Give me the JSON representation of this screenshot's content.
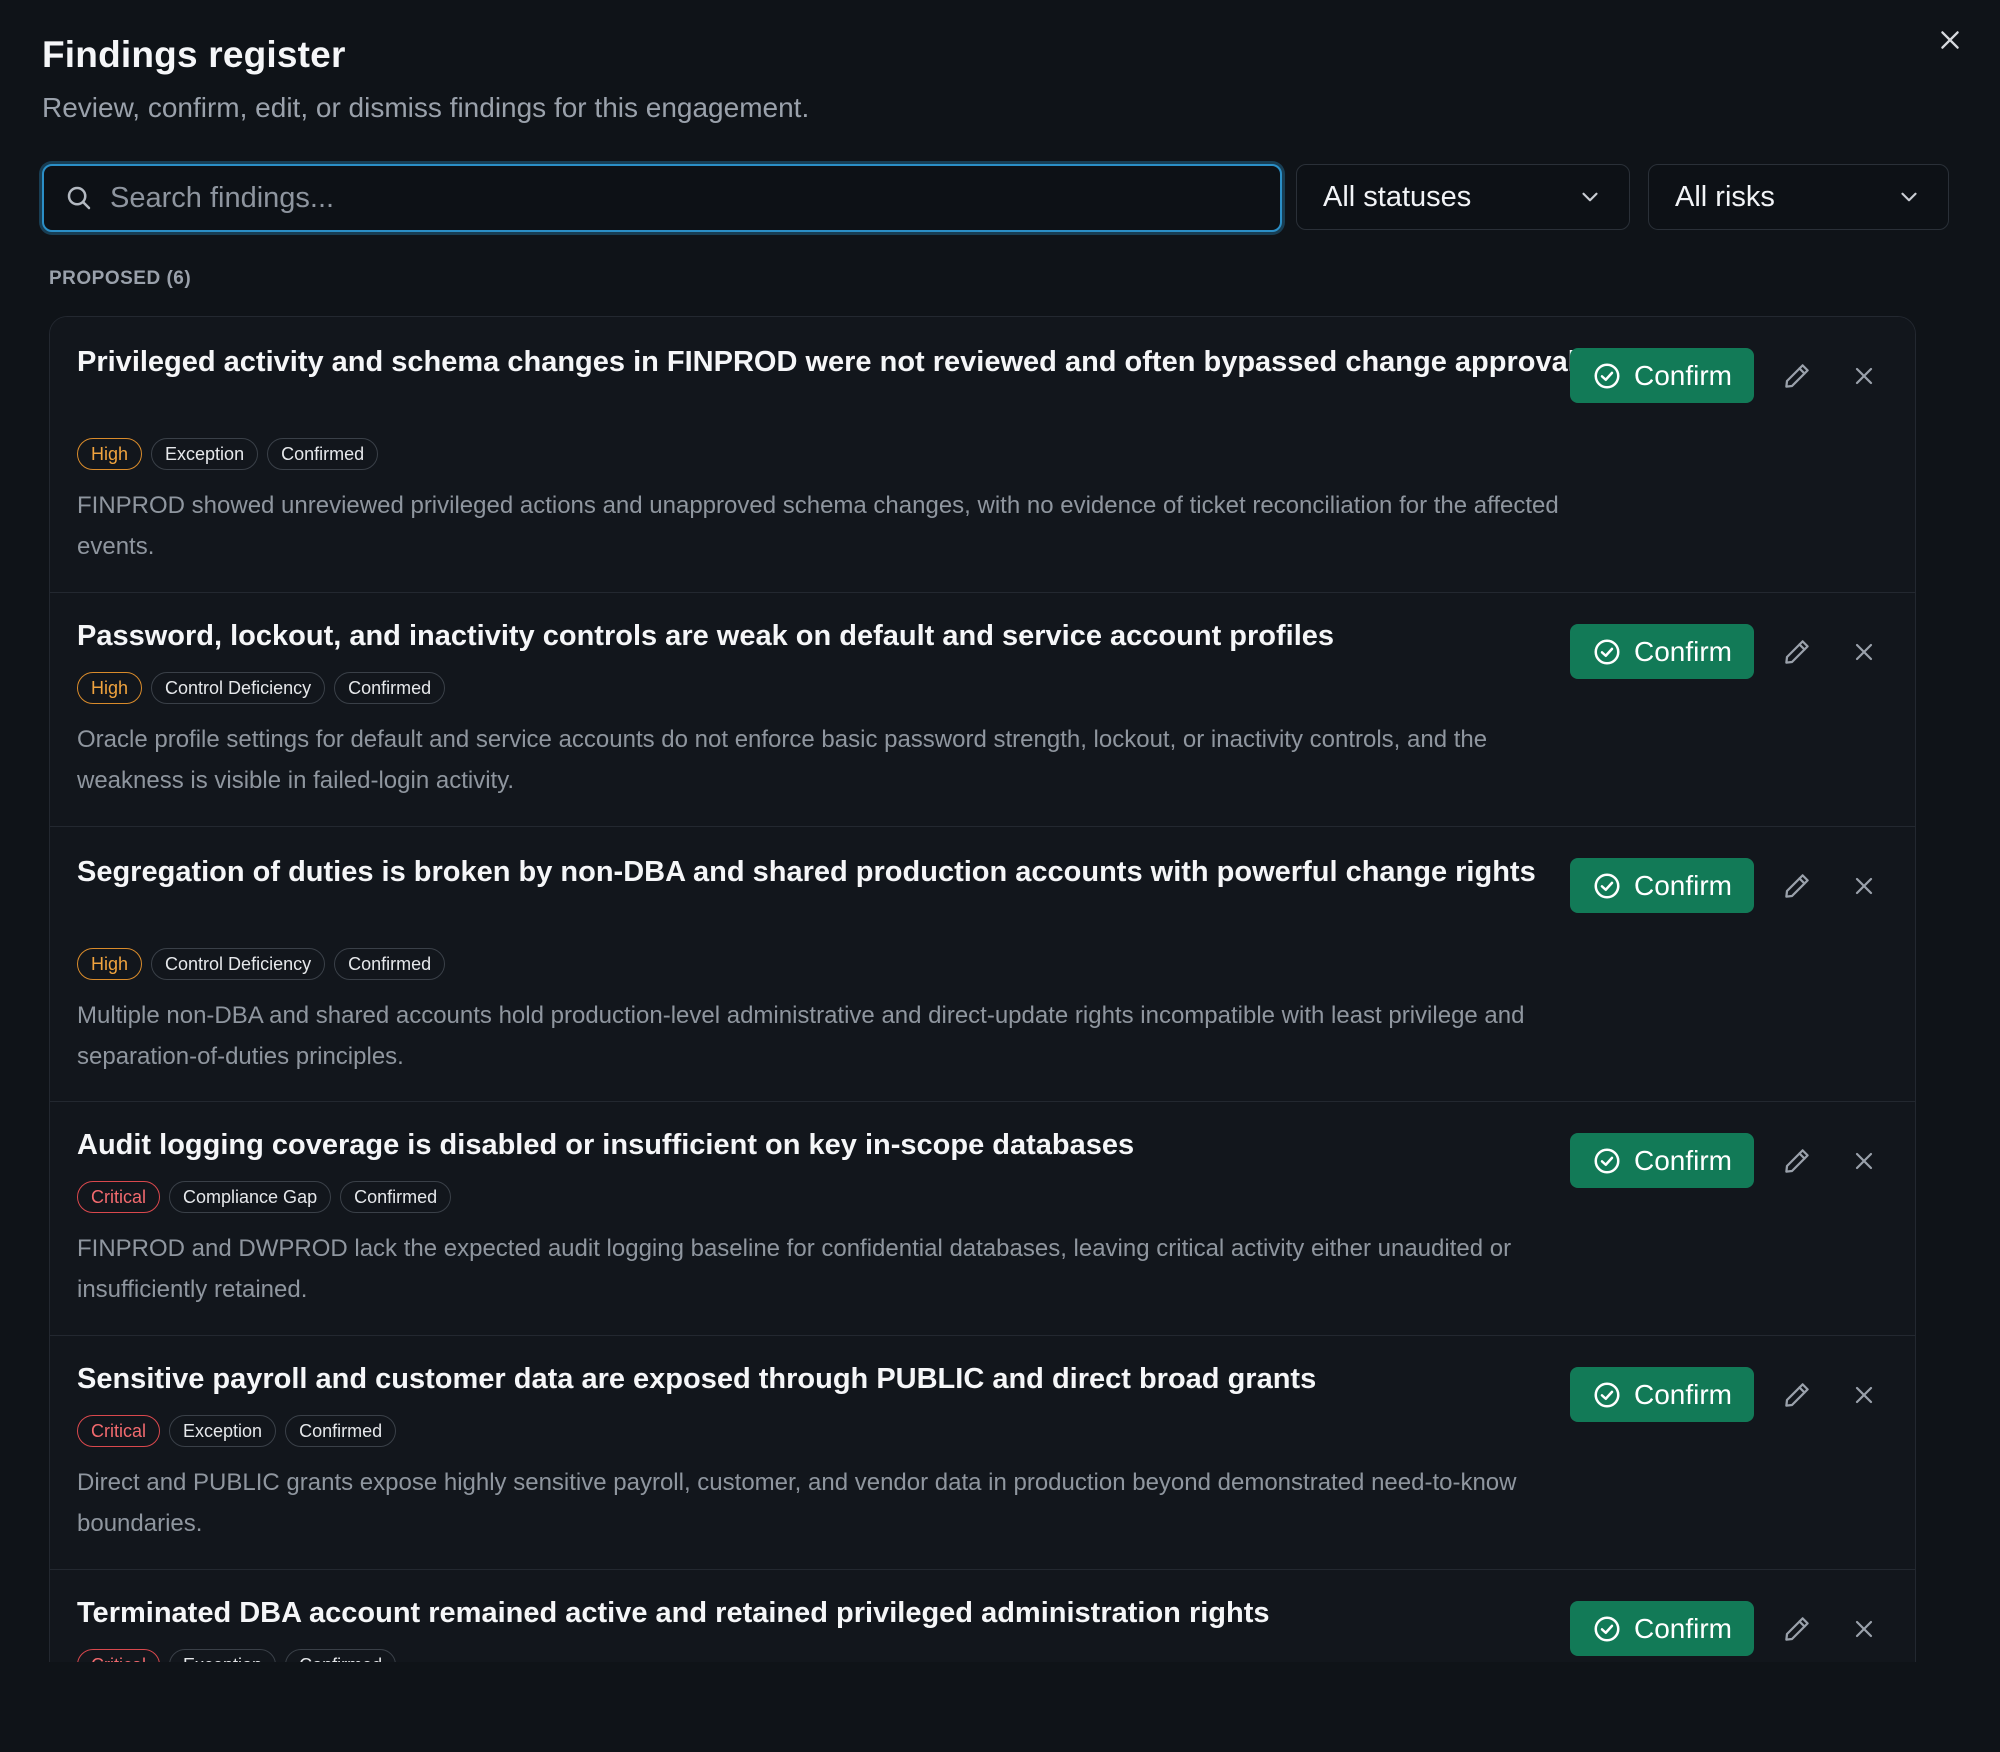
{
  "header": {
    "title": "Findings register",
    "subtitle": "Review, confirm, edit, or dismiss findings for this engagement."
  },
  "filters": {
    "search_placeholder": "Search findings...",
    "search_value": "",
    "status_selected": "All statuses",
    "risk_selected": "All risks"
  },
  "section": {
    "label": "PROPOSED (6)"
  },
  "actions": {
    "confirm_label": "Confirm"
  },
  "colors": {
    "accent_focus": "#2b8fc7",
    "confirm_green": "#127a57",
    "high": "#f0a33e",
    "critical": "#f26a6e"
  },
  "findings": [
    {
      "title": "Privileged activity and schema changes in FINPROD were not reviewed and often bypassed change approval",
      "risk": "High",
      "type": "Exception",
      "status": "Confirmed",
      "description": "FINPROD showed unreviewed privileged actions and unapproved schema changes, with no evidence of ticket reconciliation for the affected events."
    },
    {
      "title": "Password, lockout, and inactivity controls are weak on default and service account profiles",
      "risk": "High",
      "type": "Control Deficiency",
      "status": "Confirmed",
      "description": "Oracle profile settings for default and service accounts do not enforce basic password strength, lockout, or inactivity controls, and the weakness is visible in failed-login activity."
    },
    {
      "title": "Segregation of duties is broken by non-DBA and shared production accounts with powerful change rights",
      "risk": "High",
      "type": "Control Deficiency",
      "status": "Confirmed",
      "description": "Multiple non-DBA and shared accounts hold production-level administrative and direct-update rights incompatible with least privilege and separation-of-duties principles."
    },
    {
      "title": "Audit logging coverage is disabled or insufficient on key in-scope databases",
      "risk": "Critical",
      "type": "Compliance Gap",
      "status": "Confirmed",
      "description": "FINPROD and DWPROD lack the expected audit logging baseline for confidential databases, leaving critical activity either unaudited or insufficiently retained."
    },
    {
      "title": "Sensitive payroll and customer data are exposed through PUBLIC and direct broad grants",
      "risk": "Critical",
      "type": "Exception",
      "status": "Confirmed",
      "description": "Direct and PUBLIC grants expose highly sensitive payroll, customer, and vendor data in production beyond demonstrated need-to-know boundaries."
    },
    {
      "title": "Terminated DBA account remained active and retained privileged administration rights",
      "risk": "Critical",
      "type": "Exception",
      "status": "Confirmed",
      "description": ""
    }
  ]
}
